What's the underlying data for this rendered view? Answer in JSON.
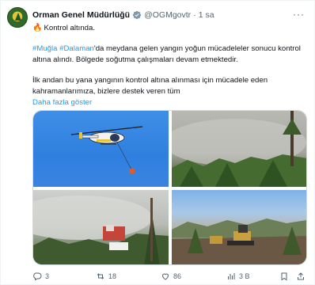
{
  "post": {
    "author_name": "Orman Genel Müdürlüğü",
    "handle": "@OGMgovtr",
    "separator": "·",
    "time": "1 sa",
    "more_label": "···",
    "line1_text": "Kontrol altında.",
    "p2_tag1": "#Muğla",
    "p2_space": " ",
    "p2_tag2": "#Dalaman",
    "p2_rest": "'da meydana gelen yangın yoğun mücadeleler sonucu kontrol altına alındı. Bölgede soğutma çalışmaları devam etmektedir.",
    "p3_text": "İlk andan bu yana yangının kontrol altına alınması için mücadele eden kahramanlarımıza, bizlere destek veren tüm",
    "show_more": "Daha fazla göster"
  },
  "actions": {
    "replies": "3",
    "reposts": "18",
    "likes": "86",
    "views": "3 B"
  },
  "media": [
    {
      "alt": "helicopter-photo"
    },
    {
      "alt": "smoke-forest-photo"
    },
    {
      "alt": "fire-truck-photo"
    },
    {
      "alt": "bulldozer-photo"
    }
  ],
  "colors": {
    "accent": "#1d9bf0",
    "muted": "#536471",
    "verified": "#829aab"
  }
}
